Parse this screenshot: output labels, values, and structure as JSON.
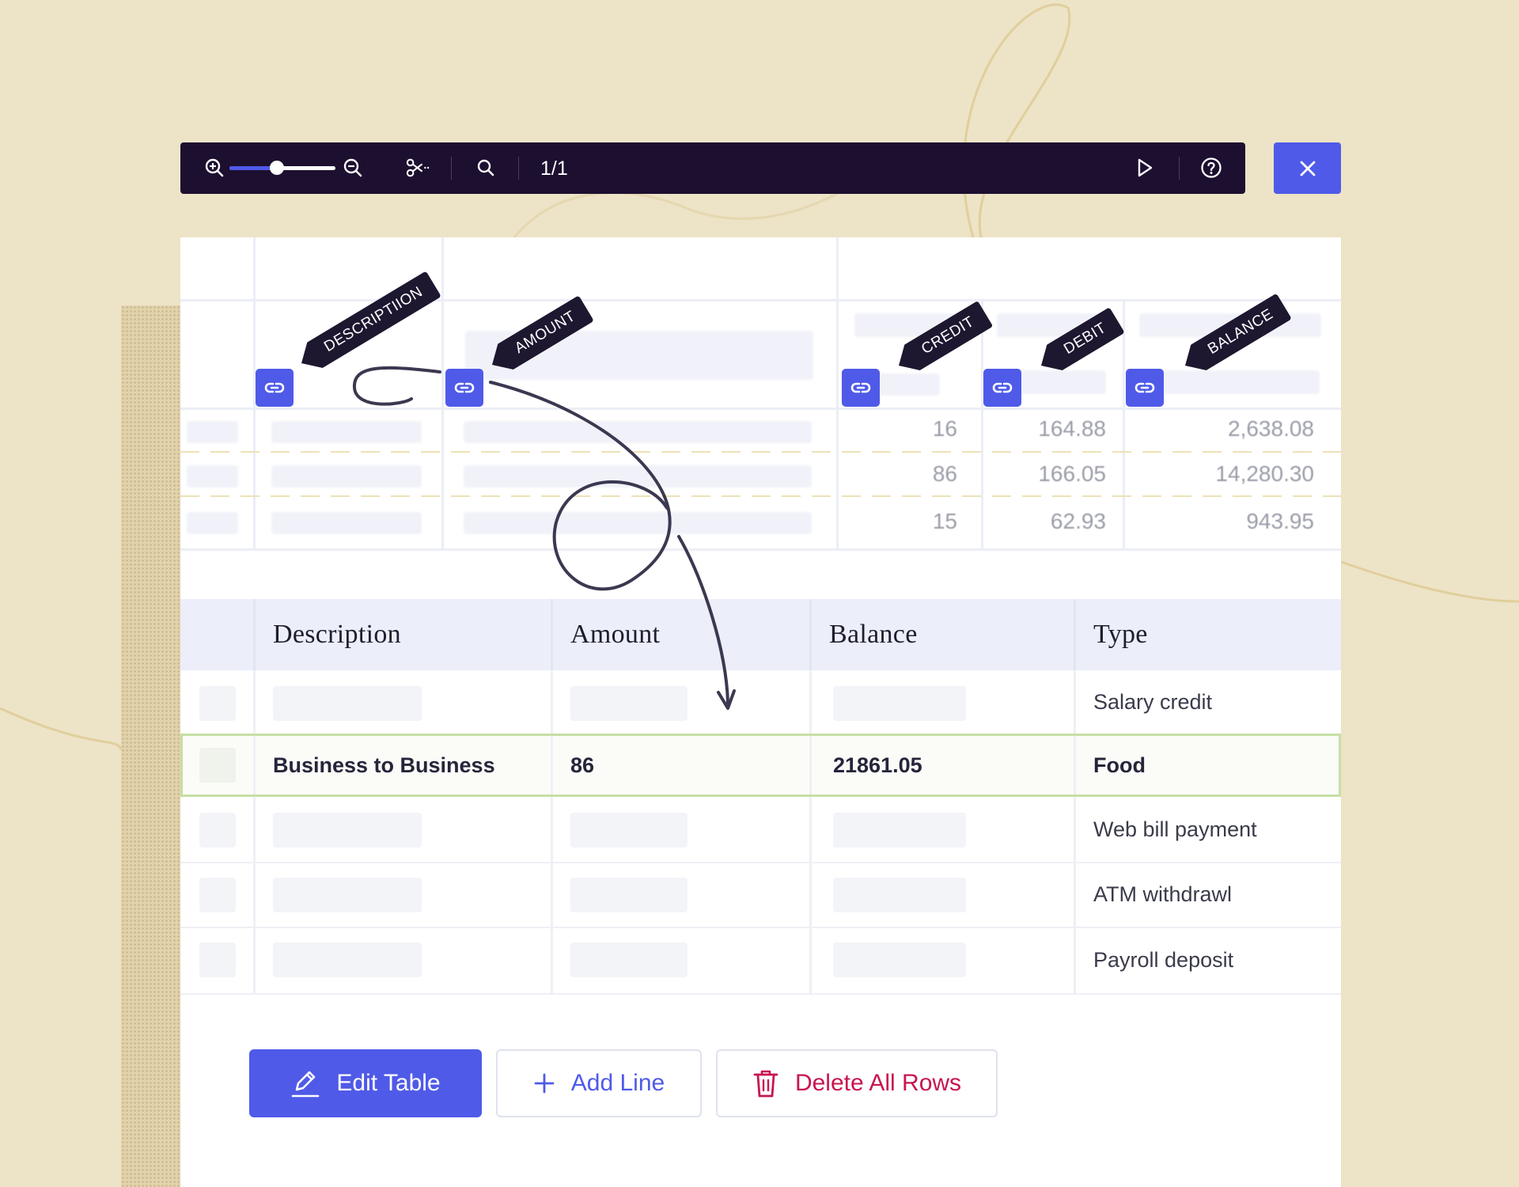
{
  "toolbar": {
    "zoom_level": 0.45,
    "page_counter": "1/1",
    "icons": [
      "zoom-in-icon",
      "zoom-out-icon",
      "scissors-icon",
      "search-icon",
      "play-icon",
      "help-icon"
    ],
    "close_icon": "close-icon"
  },
  "document": {
    "tags": [
      "DESCRIPTIION",
      "AMOUNT",
      "CREDIT",
      "DEBIT",
      "BALANCE"
    ],
    "rows": [
      {
        "credit": "16",
        "debit": "164.88",
        "balance": "2,638.08"
      },
      {
        "credit": "86",
        "debit": "166.05",
        "balance": "14,280.30"
      },
      {
        "credit": "15",
        "debit": "62.93",
        "balance": "943.95"
      }
    ]
  },
  "table": {
    "headers": {
      "description": "Description",
      "amount": "Amount",
      "balance": "Balance",
      "type": "Type"
    },
    "rows": [
      {
        "description": "",
        "amount": "",
        "balance": "",
        "type": "Salary credit"
      },
      {
        "description": "Business to Business",
        "amount": "86",
        "balance": "21861.05",
        "type": "Food"
      },
      {
        "description": "",
        "amount": "",
        "balance": "",
        "type": "Web bill payment"
      },
      {
        "description": "",
        "amount": "",
        "balance": "",
        "type": "ATM withdrawl"
      },
      {
        "description": "",
        "amount": "",
        "balance": "",
        "type": "Payroll deposit"
      }
    ]
  },
  "actions": {
    "edit_label": "Edit Table",
    "add_label": "Add Line",
    "delete_label": "Delete All Rows"
  },
  "colors": {
    "accent": "#4f5ae8",
    "toolbar_bg": "#1d0f30",
    "danger": "#c8154f",
    "highlight_border": "#c6dfa4",
    "background": "#ede3c7"
  }
}
